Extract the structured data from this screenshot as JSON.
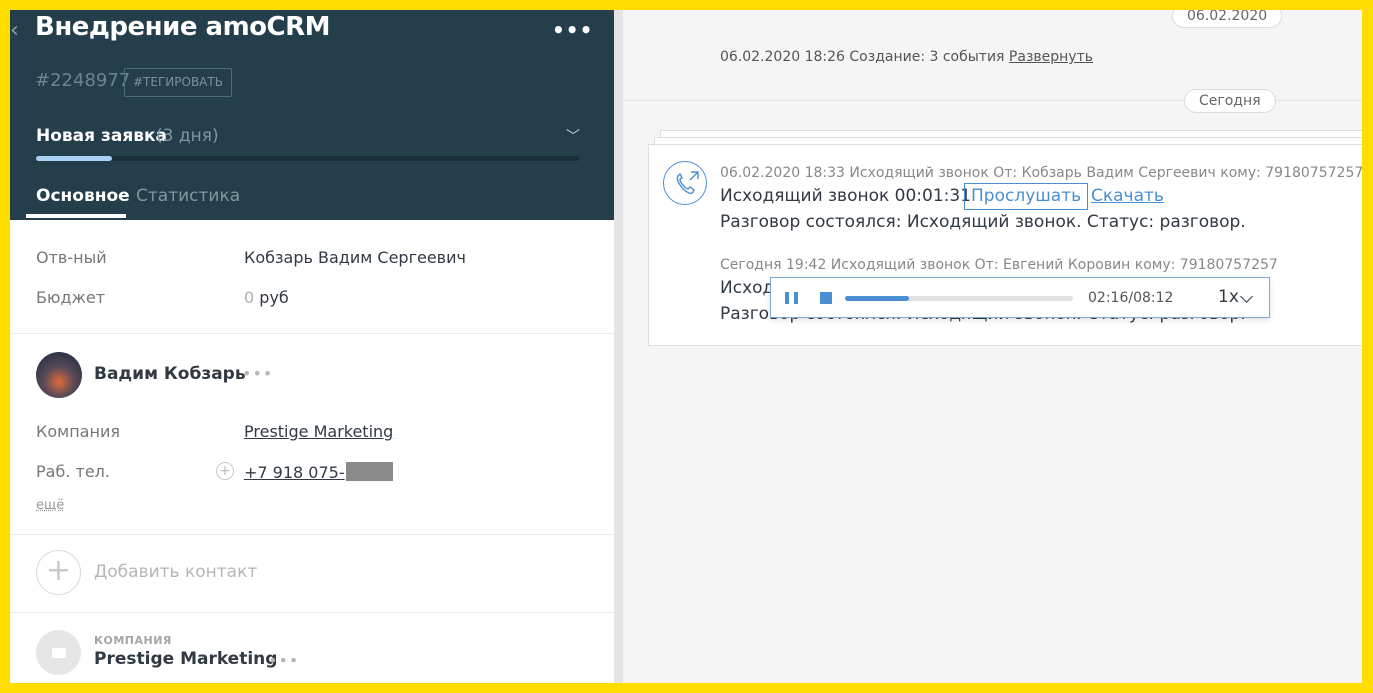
{
  "lead": {
    "title": "Внедрение amoCRM",
    "id": "#2248977",
    "tag_button": "#ТЕГИРОВАТЬ",
    "stage": "Новая заявка",
    "stage_days": "(3 дня)",
    "stage_progress": 0.14,
    "tabs": [
      "Основное",
      "Статистика"
    ]
  },
  "fields": {
    "responsible_label": "Отв-ный",
    "responsible_value": "Кобзарь Вадим Сергеевич",
    "budget_label": "Бюджет",
    "budget_amount": "0",
    "budget_currency": "руб"
  },
  "contact": {
    "name": "Вадим Кобзарь",
    "company_label": "Компания",
    "company_value": "Prestige Marketing",
    "phone_label": "Раб. тел.",
    "phone_value": "+7 918 075-",
    "more": "ещё"
  },
  "add_contact": "Добавить контакт",
  "company": {
    "caption": "КОМПАНИЯ",
    "name": "Prestige Marketing"
  },
  "feed": {
    "date_pill": "06.02.2020",
    "today_pill": "Сегодня",
    "created_text": "06.02.2020 18:26 Создание: 3 события",
    "expand_link": "Развернуть",
    "event1": {
      "meta": "06.02.2020 18:33 Исходящий звонок От: Кобзарь Вадим Сергеевич кому: 79180757257",
      "title": "Исходящий звонок 00:01:31",
      "listen": "Прослушать",
      "download": "Скачать",
      "result": "Разговор состоялся: Исходящий звонок. Статус: разговор."
    },
    "event2": {
      "meta": "Сегодня 19:42 Исходящий звонок От: Евгений Коровин кому: 79180757257",
      "title": "Исход",
      "result": "Разговор состоялся: Исходящий звонок. Статус: разговор."
    },
    "player": {
      "elapsed": "02:16",
      "total": "/08:12",
      "speed": "1x",
      "progress": 0.28
    }
  },
  "colors": {
    "header_bg": "#243e4b",
    "accent_blue": "#4a8fd4",
    "frame_yellow": "#ffdd00"
  }
}
